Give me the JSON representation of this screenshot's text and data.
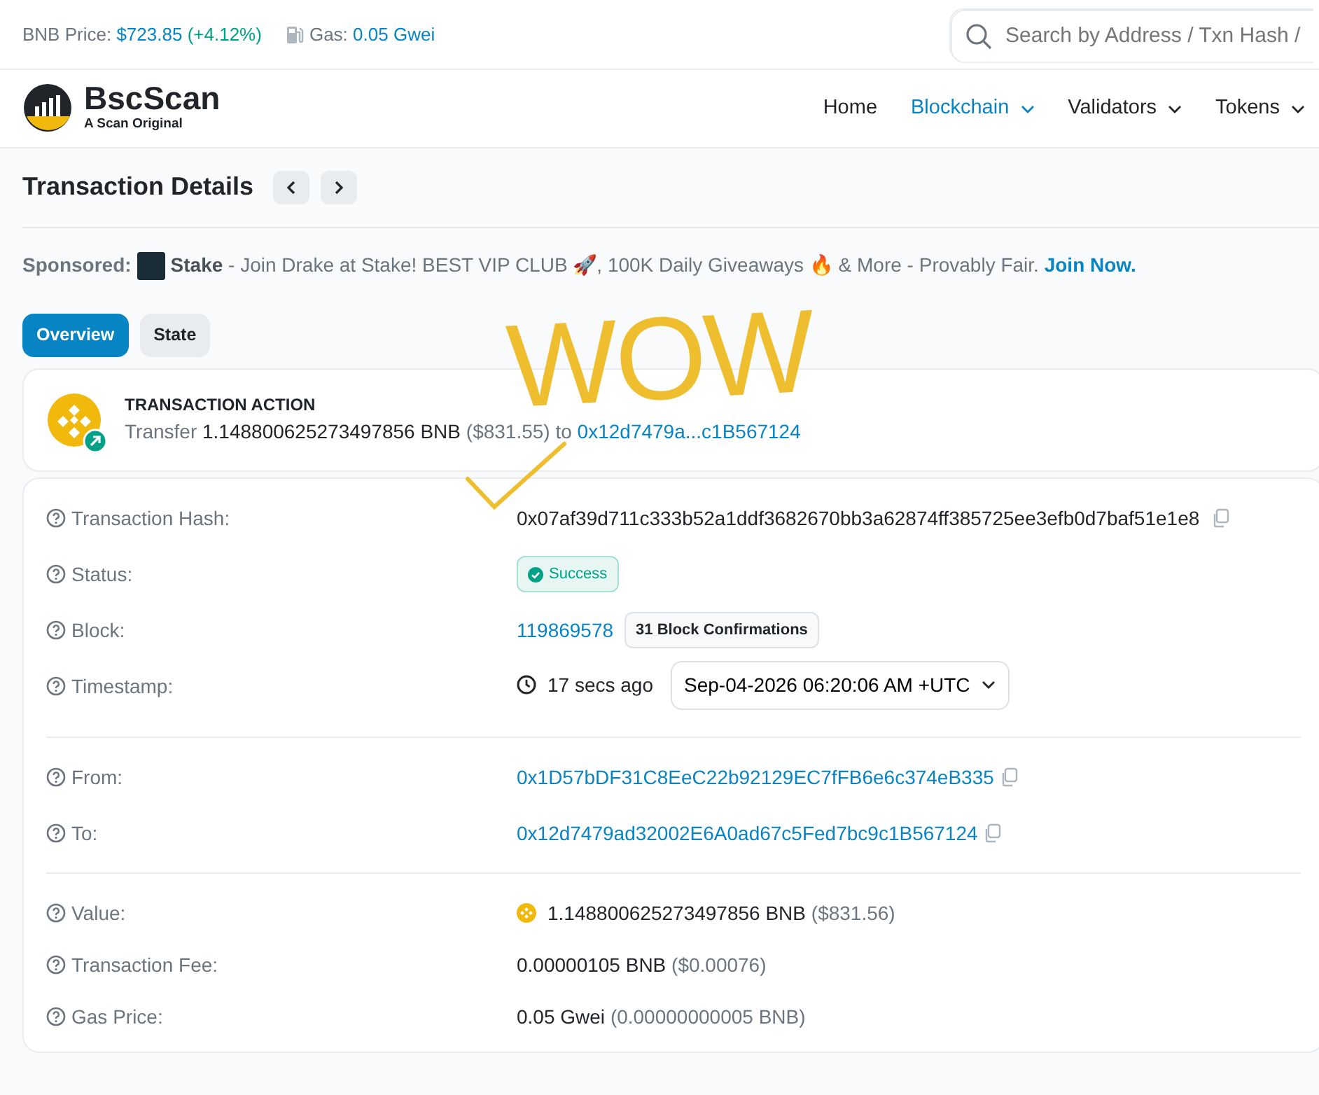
{
  "top_bar": {
    "price_label": "BNB Price:",
    "price": "$723.85",
    "change": "(+4.12%)",
    "gas_label": "Gas:",
    "gas": "0.05 Gwei"
  },
  "search": {
    "placeholder": "Search by Address / Txn Hash /"
  },
  "logo": {
    "name": "BscScan",
    "tagline": "A Scan Original"
  },
  "nav": [
    {
      "label": "Home",
      "selected": false,
      "dropdown": false
    },
    {
      "label": "Blockchain",
      "selected": true,
      "dropdown": true
    },
    {
      "label": "Validators",
      "selected": false,
      "dropdown": true
    },
    {
      "label": "Tokens",
      "selected": false,
      "dropdown": true
    }
  ],
  "page_title": "Transaction Details",
  "sponsored": {
    "label": "Sponsored:",
    "brand": "Stake",
    "text": "- Join Drake at Stake! BEST VIP CLUB 🚀, 100K Daily Giveaways 🔥 & More - Provably Fair.",
    "link": "Join Now."
  },
  "tabs": [
    {
      "label": "Overview",
      "selected": true
    },
    {
      "label": "State",
      "selected": false
    }
  ],
  "action": {
    "title": "TRANSACTION ACTION",
    "text": "Transfer **1.148800625273497856 BNB** ($831.55) to",
    "address": "0x12d7479a...c1B567124"
  },
  "details": [
    [
      {
        "kind": "hash",
        "label": "Transaction Hash:",
        "value": "0x07af39d711c333b52a1ddf3682670bb3a62874ff385725ee3efb0d7baf51e1e8"
      },
      {
        "kind": "status",
        "label": "Status:",
        "value": "Success"
      },
      {
        "kind": "block",
        "label": "Block:",
        "value": "119869578",
        "badge": "31 Block Confirmations"
      },
      {
        "kind": "timestamp",
        "label": "Timestamp:",
        "value": "17 secs ago",
        "badge": "Sep-04-2026 06:20:06 AM +UTC"
      }
    ],
    [
      {
        "kind": "address",
        "label": "From:",
        "value": "0x1D57bDF31C8EeC22b92129EC7fFB6e6c374eB335"
      },
      {
        "kind": "address",
        "label": "To:",
        "value": "0x12d7479ad32002E6A0ad67c5Fed7bc9c1B567124"
      }
    ],
    [
      {
        "kind": "coin",
        "label": "Value:",
        "value": "1.148800625273497856 BNB",
        "note": "($831.56)"
      },
      {
        "kind": "amount",
        "label": "Transaction Fee:",
        "value": "0.00000105 BNB",
        "note": "($0.00076)"
      },
      {
        "kind": "amount",
        "label": "Gas Price:",
        "value": "0.05 Gwei",
        "note": "(0.00000000005 BNB)"
      }
    ]
  ],
  "annotation": {
    "text": "WOW"
  }
}
